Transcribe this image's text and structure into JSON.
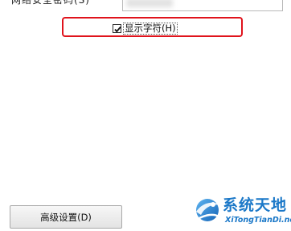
{
  "top_row": {
    "label": "网络安全密码(S)"
  },
  "checkbox": {
    "label": "显示字符(H)",
    "checked": true
  },
  "highlight": {
    "color": "#e0131c"
  },
  "advanced_button": {
    "label": "高级设置(D)"
  },
  "watermark": {
    "title": "系统天地",
    "url": "XiTongTianDi.net",
    "brand_color": "#1b78c8"
  }
}
